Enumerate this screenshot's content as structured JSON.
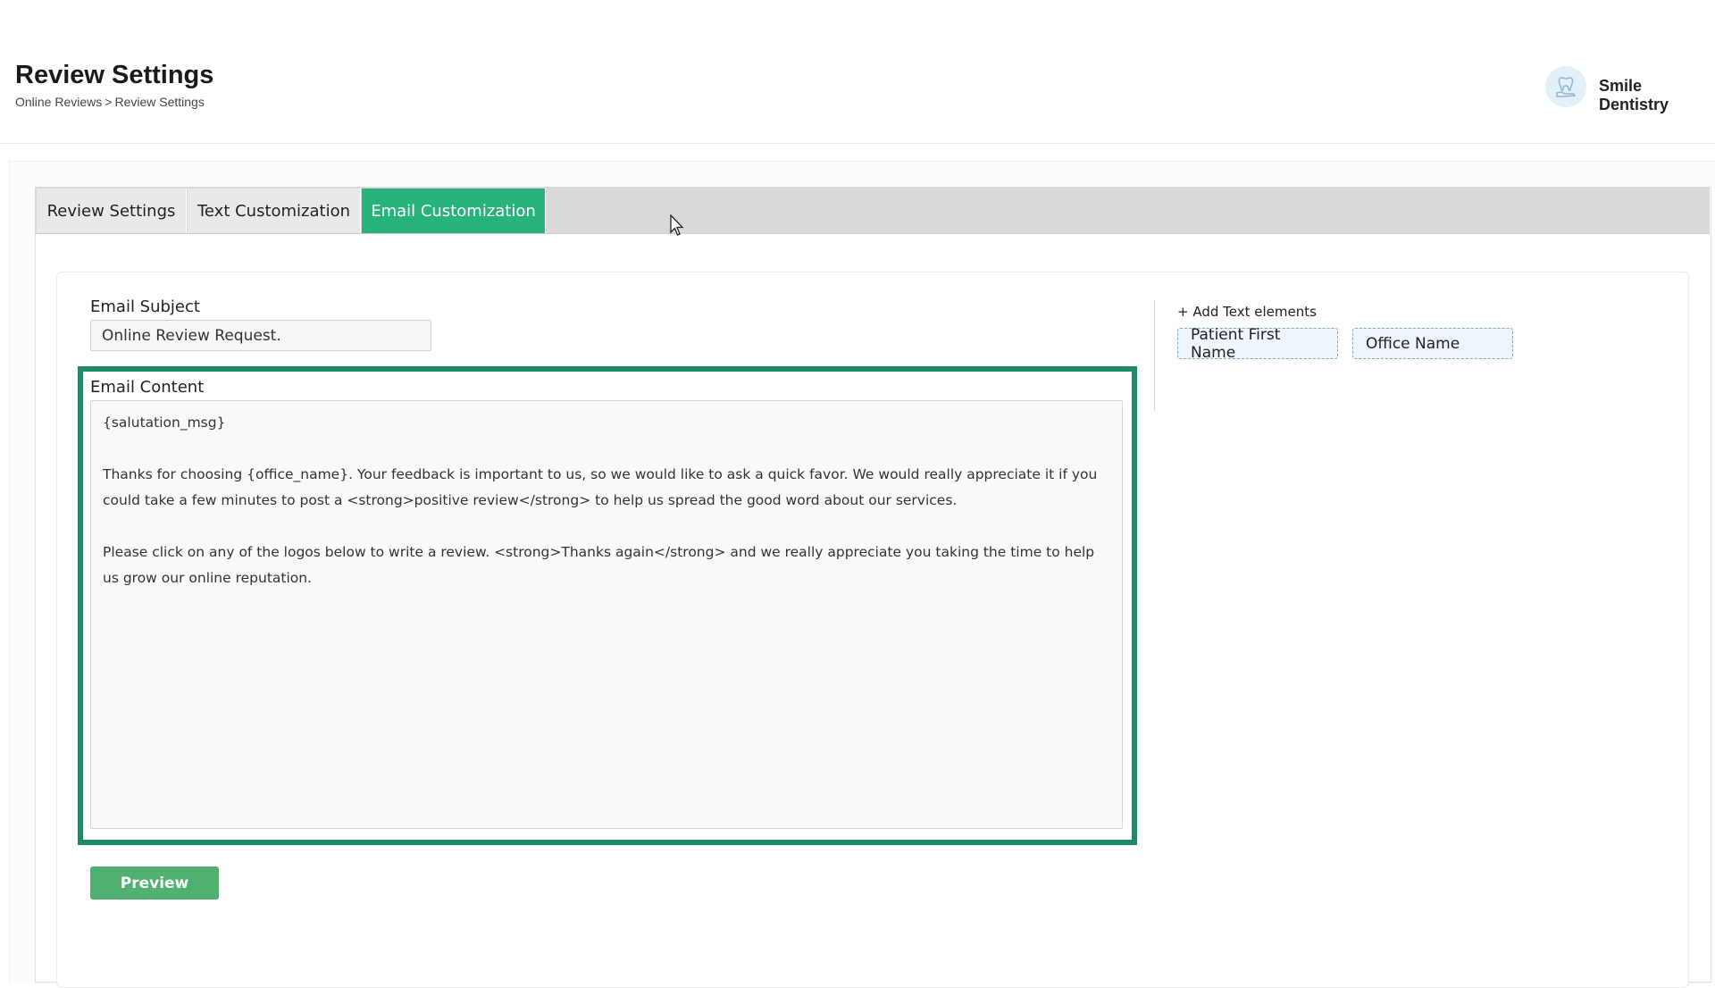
{
  "header": {
    "title": "Review Settings",
    "breadcrumb": {
      "parent": "Online Reviews",
      "separator": ">",
      "current": "Review Settings"
    },
    "office_name": "Smile Dentistry",
    "avatar_icon": "tooth-hand-icon"
  },
  "tabs": [
    {
      "label": "Review Settings",
      "active": false
    },
    {
      "label": "Text Customization",
      "active": false
    },
    {
      "label": "Email Customization",
      "active": true
    }
  ],
  "form": {
    "subject_label": "Email Subject",
    "subject_value": "Online Review Request.",
    "content_label": "Email Content",
    "content_lines": [
      "{salutation_msg}",
      "Thanks for choosing {office_name}. Your feedback is important to us, so we would like to ask a quick favor. We would really appreciate it if you could take a few minutes to post a <strong>positive review</strong> to help us spread the good word about our services.",
      "Please click on any of the logos below to write a review. <strong>Thanks again</strong> and we really appreciate you taking the time to help us grow our online reputation."
    ],
    "preview_label": "Preview"
  },
  "text_elements": {
    "heading": "+ Add Text elements",
    "chips": [
      "Patient First Name",
      "Office Name"
    ]
  },
  "colors": {
    "active_tab": "#27b37a",
    "highlight_border": "#1f8a6a",
    "preview_button": "#4fb06f"
  }
}
